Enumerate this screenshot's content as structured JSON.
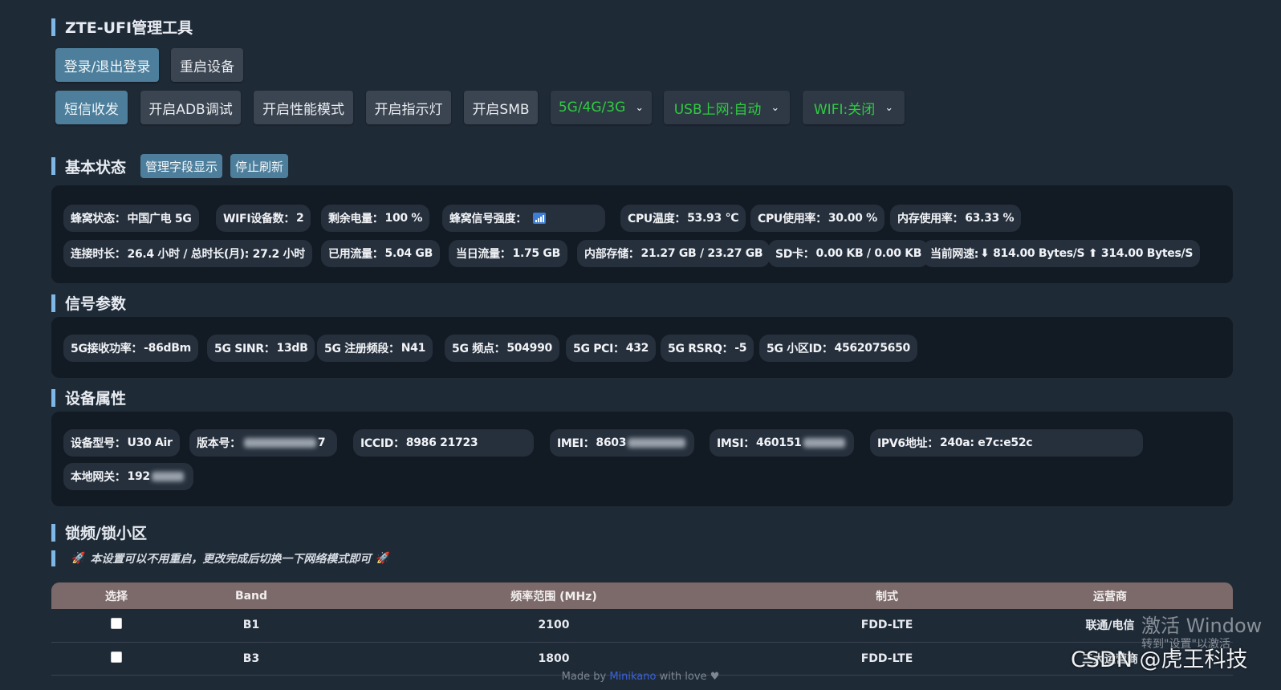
{
  "app_title": "ZTE-UFI管理工具",
  "toolbar1": {
    "login": "登录/退出登录",
    "reboot": "重启设备"
  },
  "toolbar2": {
    "sms": "短信收发",
    "adb": "开启ADB调试",
    "perf": "开启性能模式",
    "led": "开启指示灯",
    "smb": "开启SMB",
    "net_mode": "5G/4G/3G",
    "usb": "USB上网:自动",
    "wifi": "WIFI:关闭"
  },
  "basic": {
    "title": "基本状态",
    "manage_fields": "管理字段显示",
    "stop_refresh": "停止刷新",
    "row1": [
      {
        "label": "蜂窝状态：",
        "value": "中国广电 5G"
      },
      {
        "label": "WIFI设备数：",
        "value": "2"
      },
      {
        "label": "剩余电量：",
        "value": "100 %"
      },
      {
        "label": "蜂窝信号强度：",
        "value": ""
      },
      {
        "label": "CPU温度：",
        "value": "53.93 ℃"
      },
      {
        "label": "CPU使用率：",
        "value": "30.00 %"
      },
      {
        "label": "内存使用率：",
        "value": "63.33 %"
      }
    ],
    "row2": [
      {
        "label": "连接时长：",
        "value": "26.4 小时 / 总时长(月): 27.2 小时"
      },
      {
        "label": "已用流量：",
        "value": "5.04 GB"
      },
      {
        "label": "当日流量：",
        "value": "1.75 GB"
      },
      {
        "label": "内部存储：",
        "value": "21.27 GB / 23.27 GB"
      },
      {
        "label": "SD卡：",
        "value": "0.00 KB / 0.00 KB"
      },
      {
        "label": "当前网速: ",
        "value": "⬇ 814.00 Bytes/S ⬆ 314.00 Bytes/S"
      }
    ]
  },
  "signal": {
    "title": "信号参数",
    "items": [
      {
        "label": "5G接收功率：",
        "value": "-86dBm"
      },
      {
        "label": "5G SINR：",
        "value": "13dB"
      },
      {
        "label": "5G 注册频段：",
        "value": "N41"
      },
      {
        "label": "5G 频点：",
        "value": "504990"
      },
      {
        "label": "5G PCI：",
        "value": "432"
      },
      {
        "label": "5G RSRQ：",
        "value": "-5"
      },
      {
        "label": "5G 小区ID：",
        "value": "4562075650"
      }
    ]
  },
  "device": {
    "title": "设备属性",
    "items": [
      {
        "label": "设备型号：",
        "value": "U30 Air"
      },
      {
        "label": "版本号：",
        "value": "7"
      },
      {
        "label": "ICCID：",
        "value": "8986 21723"
      },
      {
        "label": "IMEI：",
        "value": "8603"
      },
      {
        "label": "IMSI：",
        "value": "460151"
      },
      {
        "label": "IPV6地址：",
        "value": "240a: e7c:e52c"
      },
      {
        "label": "本地网关：",
        "value": "192"
      }
    ]
  },
  "lock": {
    "title": "锁频/锁小区",
    "note": "本设置可以不用重启，更改完成后切换一下网络模式即可",
    "columns": [
      "选择",
      "Band",
      "频率范围 (MHz)",
      "制式",
      "运营商"
    ],
    "rows": [
      {
        "band": "B1",
        "freq": "2100",
        "mode": "FDD-LTE",
        "carrier": "联通/电信"
      },
      {
        "band": "B3",
        "freq": "1800",
        "mode": "FDD-LTE",
        "carrier": "三大运营商"
      }
    ]
  },
  "footer": {
    "prefix": "Made by ",
    "author": "Minikano",
    "suffix": " with love ♥"
  },
  "watermark": {
    "line1": "激活 Window",
    "line2": "转到\"设置\"以激活",
    "csdn": "CSDN @虎王科技"
  }
}
